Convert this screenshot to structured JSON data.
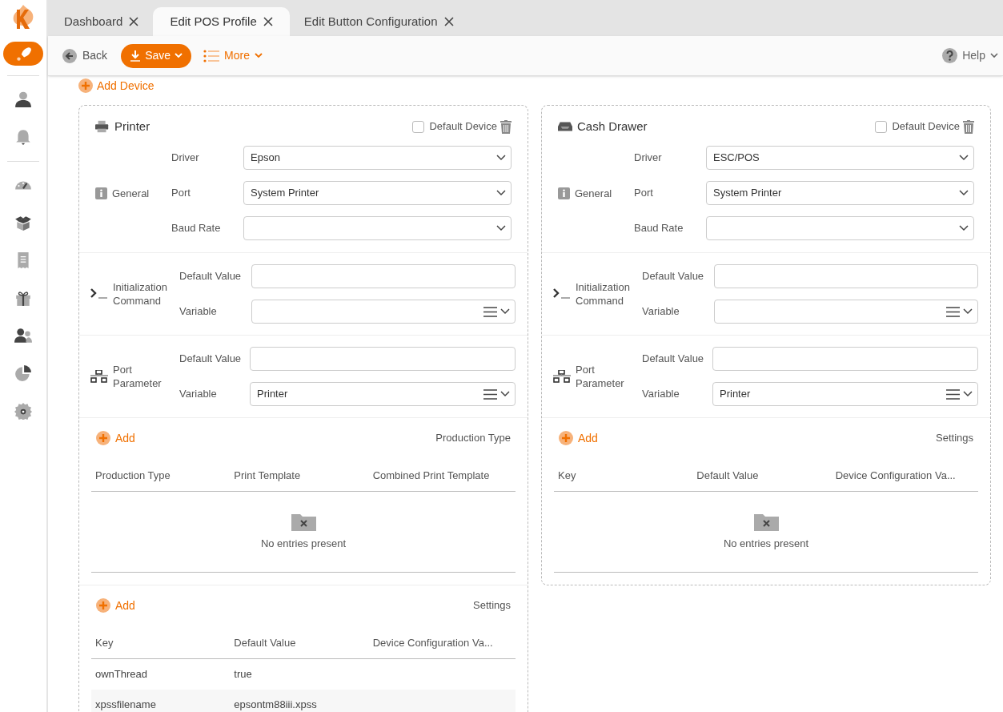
{
  "sidebar": {
    "items": [
      {
        "kind": "rocket",
        "selected": true
      },
      {
        "kind": "user",
        "selected": false
      },
      {
        "kind": "bell",
        "selected": false
      },
      {
        "kind": "gauge",
        "selected": false
      },
      {
        "kind": "box",
        "selected": false
      },
      {
        "kind": "receipt",
        "selected": false
      },
      {
        "kind": "gift",
        "selected": false
      },
      {
        "kind": "users",
        "selected": false
      },
      {
        "kind": "pie",
        "selected": false
      },
      {
        "kind": "gear",
        "selected": false
      }
    ]
  },
  "tabs": [
    {
      "label": "Dashboard",
      "selected": false
    },
    {
      "label": "Edit POS Profile",
      "selected": true
    },
    {
      "label": "Edit Button Configuration",
      "selected": false
    }
  ],
  "toolbar": {
    "back": "Back",
    "save": "Save",
    "more": "More",
    "help": "Help"
  },
  "add_device": "Add Device",
  "devices": [
    {
      "kind": "printer",
      "title": "Printer",
      "default_device": {
        "label": "Default Device",
        "checked": false
      },
      "general": {
        "label": "General",
        "fields": [
          {
            "label": "Driver",
            "value": "Epson"
          },
          {
            "label": "Port",
            "value": "System Printer"
          },
          {
            "label": "Baud Rate"
          }
        ]
      },
      "init_command": {
        "label": "Initialization Command",
        "default_label": "Default Value",
        "variable_label": "Variable"
      },
      "port_parameter": {
        "label": "Port Parameter",
        "default_label": "Default Value",
        "variable_label": "Variable",
        "variable_value": "Printer"
      },
      "tables": [
        {
          "add": "Add",
          "title": "Production Type",
          "columns": [
            "Production Type",
            "Print Template",
            "Combined Print Template"
          ],
          "empty": "No entries present"
        },
        {
          "add": "Add",
          "title": "Settings",
          "columns": [
            "Key",
            "Default Value",
            "Device Configuration Va..."
          ],
          "rows": [
            [
              "ownThread",
              "true"
            ],
            [
              "xpssfilename",
              "epsontm88iii.xpss"
            ]
          ]
        }
      ]
    },
    {
      "kind": "cash_drawer",
      "title": "Cash Drawer",
      "default_device": {
        "label": "Default Device",
        "checked": false
      },
      "general": {
        "label": "General",
        "fields": [
          {
            "label": "Driver",
            "value": "ESC/POS"
          },
          {
            "label": "Port",
            "value": "System Printer"
          },
          {
            "label": "Baud Rate"
          }
        ]
      },
      "init_command": {
        "label": "Initialization Command",
        "default_label": "Default Value",
        "variable_label": "Variable"
      },
      "port_parameter": {
        "label": "Port Parameter",
        "default_label": "Default Value",
        "variable_label": "Variable",
        "variable_value": "Printer"
      },
      "tables": [
        {
          "add": "Add",
          "title": "Settings",
          "columns": [
            "Key",
            "Default Value",
            "Device Configuration Va..."
          ],
          "empty": "No entries present"
        }
      ]
    }
  ]
}
